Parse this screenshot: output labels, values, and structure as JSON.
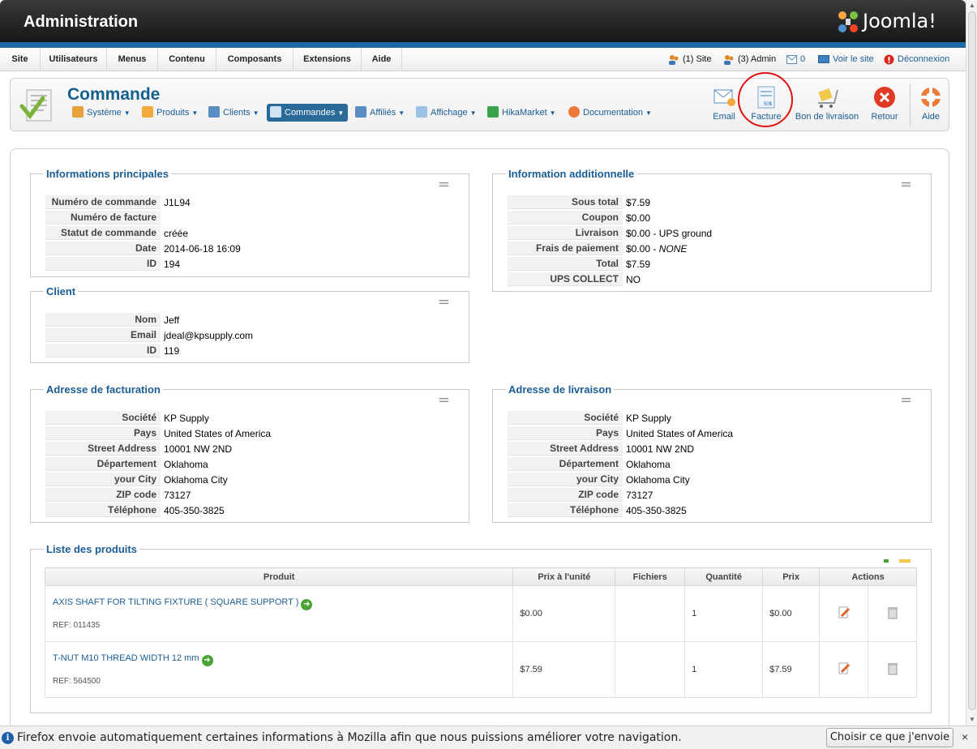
{
  "header": {
    "title": "Administration",
    "brand": "Joomla!"
  },
  "menu": {
    "items": [
      {
        "label": "Site"
      },
      {
        "label": "Utilisateurs"
      },
      {
        "label": "Menus"
      },
      {
        "label": "Contenu"
      },
      {
        "label": "Composants"
      },
      {
        "label": "Extensions"
      },
      {
        "label": "Aide"
      }
    ],
    "status": {
      "site_visitors": "(1) Site",
      "admins": "(3) Admin",
      "messages": "0",
      "view_site": "Voir le site",
      "logout": "Déconnexion"
    }
  },
  "toolbar": {
    "page_title": "Commande",
    "submenu": [
      {
        "label": "Système"
      },
      {
        "label": "Produits"
      },
      {
        "label": "Clients"
      },
      {
        "label": "Commandes",
        "active": true
      },
      {
        "label": "Affiliés"
      },
      {
        "label": "Affichage"
      },
      {
        "label": "HikaMarket"
      },
      {
        "label": "Documentation"
      }
    ],
    "buttons": {
      "email": "Email",
      "invoice": "Facture",
      "invoice_amount": "50$",
      "delivery": "Bon de livraison",
      "back": "Retour",
      "help": "Aide"
    }
  },
  "main_info": {
    "legend": "Informations principales",
    "rows": [
      {
        "label": "Numéro de commande",
        "value": "J1L94"
      },
      {
        "label": "Numéro de facture",
        "value": ""
      },
      {
        "label": "Statut de commande",
        "value": "créée"
      },
      {
        "label": "Date",
        "value": "2014-06-18 16:09"
      },
      {
        "label": "ID",
        "value": "194"
      }
    ]
  },
  "additional_info": {
    "legend": "Information additionnelle",
    "rows": [
      {
        "label": "Sous total",
        "value": "$7.59"
      },
      {
        "label": "Coupon",
        "value": "$0.00"
      },
      {
        "label": "Livraison",
        "value": "$0.00 - UPS ground"
      },
      {
        "label": "Frais de paiement",
        "value": "$0.00 - ",
        "value_em": "NONE"
      },
      {
        "label": "Total",
        "value": "$7.59"
      },
      {
        "label": "UPS COLLECT",
        "value": "NO"
      }
    ]
  },
  "customer": {
    "legend": "Client",
    "rows": [
      {
        "label": "Nom",
        "value": "Jeff"
      },
      {
        "label": "Email",
        "value": "jdeal@kpsupply.com"
      },
      {
        "label": "ID",
        "value": "119"
      }
    ]
  },
  "billing": {
    "legend": "Adresse de facturation",
    "rows": [
      {
        "label": "Société",
        "value": "KP Supply"
      },
      {
        "label": "Pays",
        "value": "United States of America"
      },
      {
        "label": "Street Address",
        "value": "10001 NW 2ND"
      },
      {
        "label": "Département",
        "value": "Oklahoma"
      },
      {
        "label": "your City",
        "value": "Oklahoma City"
      },
      {
        "label": "ZIP code",
        "value": "73127"
      },
      {
        "label": "Téléphone",
        "value": "405-350-3825"
      }
    ]
  },
  "shipping": {
    "legend": "Adresse de livraison",
    "rows": [
      {
        "label": "Société",
        "value": "KP Supply"
      },
      {
        "label": "Pays",
        "value": "United States of America"
      },
      {
        "label": "Street Address",
        "value": "10001 NW 2ND"
      },
      {
        "label": "Département",
        "value": "Oklahoma"
      },
      {
        "label": "your City",
        "value": "Oklahoma City"
      },
      {
        "label": "ZIP code",
        "value": "73127"
      },
      {
        "label": "Téléphone",
        "value": "405-350-3825"
      }
    ]
  },
  "products": {
    "legend": "Liste des produits",
    "columns": [
      "Produit",
      "Prix à l'unité",
      "Fichiers",
      "Quantité",
      "Prix",
      "Actions"
    ],
    "rows": [
      {
        "name": "AXIS SHAFT FOR TILTING FIXTURE ( SQUARE SUPPORT )",
        "ref": "REF: 011435",
        "unit_price": "$0.00",
        "files": "",
        "quantity": "1",
        "price": "$0.00"
      },
      {
        "name": "T-NUT M10 THREAD WIDTH 12 mm",
        "ref": "REF: 564500",
        "unit_price": "$7.59",
        "files": "",
        "quantity": "1",
        "price": "$7.59"
      }
    ]
  },
  "notification": {
    "text": "Firefox envoie automatiquement certaines informations à Mozilla afin que nous puissions améliorer votre navigation.",
    "button": "Choisir ce que j'envoie",
    "close": "×",
    "info_glyph": "i"
  },
  "colors": {
    "accent": "#1a5d94",
    "header_bg": "#1e1e1e",
    "strip": "#1b6aa5",
    "highlight_circle": "#e01010"
  }
}
